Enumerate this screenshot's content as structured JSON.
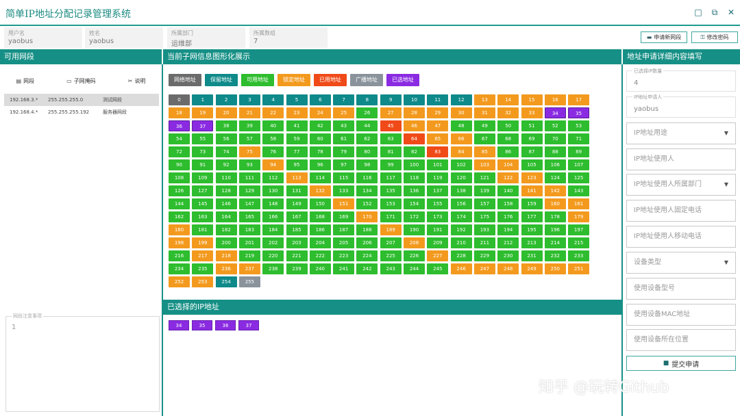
{
  "window": {
    "title": "简单IP地址分配记录管理系统",
    "controls": [
      "minimize",
      "restore",
      "close"
    ]
  },
  "user_info": [
    {
      "label": "用户名",
      "value": "yaobus"
    },
    {
      "label": "姓名",
      "value": "yaobus"
    },
    {
      "label": "所属部门",
      "value": "运维部"
    },
    {
      "label": "所属数组",
      "value": "7"
    }
  ],
  "top_buttons": {
    "apply_new": "申请新网段",
    "change_password": "修改密码"
  },
  "sections": {
    "available": "可用网段",
    "current": "当前子网信息图形化展示",
    "selected": "已选择的IP地址",
    "form": "地址申请详细内容填写"
  },
  "left_tools": [
    {
      "icon": "list-icon",
      "label": "网段"
    },
    {
      "icon": "card-icon",
      "label": "子网掩码"
    },
    {
      "icon": "tools-icon",
      "label": "说明"
    }
  ],
  "networks": [
    {
      "segment": "192.168.3.*",
      "mask": "255.255.255.0",
      "note": "测试网段",
      "selected": true
    },
    {
      "segment": "192.168.4.*",
      "mask": "255.255.255.192",
      "note": "服务器网段",
      "selected": false
    }
  ],
  "notes": {
    "label": "网段注意事项",
    "value": "1"
  },
  "legend": [
    {
      "label": "网络地址",
      "color": "#6b6b6b"
    },
    {
      "label": "保留地址",
      "color": "#0f8a8a"
    },
    {
      "label": "可用地址",
      "color": "#2ebd2e"
    },
    {
      "label": "锁定地址",
      "color": "#f39a1e"
    },
    {
      "label": "已用地址",
      "color": "#f04a18"
    },
    {
      "label": "广播地址",
      "color": "#8a939c"
    },
    {
      "label": "已选地址",
      "color": "#8a2be2"
    }
  ],
  "ip_grid": {
    "network": [
      0
    ],
    "reserved": [
      1,
      2,
      3,
      4,
      5,
      6,
      7,
      8,
      9,
      10,
      11,
      12,
      254
    ],
    "locked": [
      13,
      14,
      15,
      16,
      17,
      18,
      19,
      20,
      21,
      22,
      23,
      24,
      25,
      27,
      28,
      29,
      30,
      31,
      32,
      33,
      46,
      47,
      65,
      66,
      75,
      84,
      85,
      94,
      103,
      104,
      113,
      122,
      123,
      132,
      141,
      142,
      151,
      160,
      161,
      170,
      179,
      180,
      189,
      198,
      199,
      208,
      217,
      218,
      227,
      236,
      237,
      246,
      247,
      248,
      249,
      250,
      251,
      252,
      253
    ],
    "used": [
      45,
      64,
      83
    ],
    "broadcast": [
      255
    ],
    "selected": [
      34,
      35,
      36,
      37
    ]
  },
  "selected_ips": [
    "34",
    "35",
    "36",
    "37"
  ],
  "form": {
    "selected_count_label": "已选择IP数量",
    "selected_count": "4",
    "applicant_label": "IP地址申请人",
    "applicant": "yaobus",
    "usage_placeholder": "IP地址用途",
    "user_placeholder": "IP地址使用人",
    "department_placeholder": "IP地址使用人所属部门",
    "phone_placeholder": "IP地址使用人固定电话",
    "mobile_placeholder": "IP地址使用人移动电话",
    "device_type_placeholder": "设备类型",
    "device_model_placeholder": "使用设备型号",
    "mac_placeholder": "使用设备MAC地址",
    "location_placeholder": "使用设备所在位置",
    "submit_label": "提交申请"
  },
  "watermark": "知乎 @玩转Github"
}
